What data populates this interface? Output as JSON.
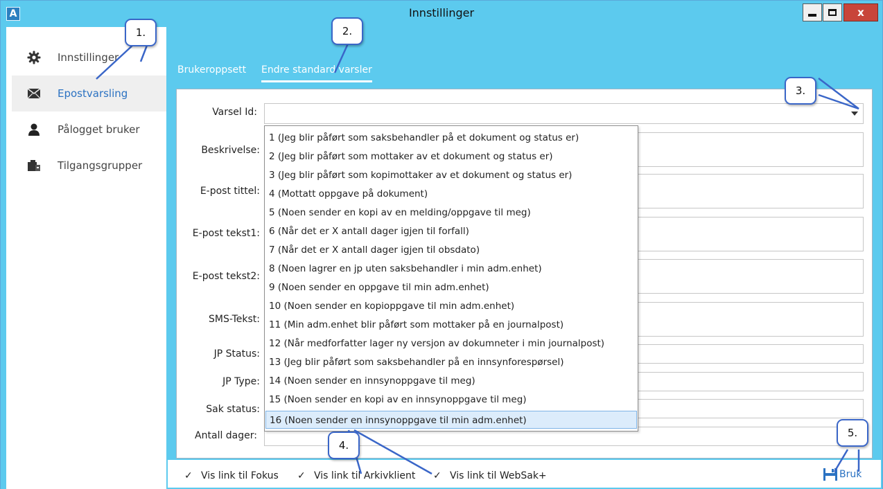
{
  "window": {
    "title": "Innstillinger",
    "app_icon": "A",
    "close_label": "x"
  },
  "sidebar": {
    "items": [
      {
        "label": "Innstillinger",
        "icon": "gear-icon"
      },
      {
        "label": "Epostvarsling",
        "icon": "envelope-icon"
      },
      {
        "label": "Pålogget bruker",
        "icon": "user-icon"
      },
      {
        "label": "Tilgangsgrupper",
        "icon": "group-icon"
      }
    ]
  },
  "tabs": [
    {
      "label": "Brukeroppsett"
    },
    {
      "label": "Endre standard varsler"
    }
  ],
  "form": {
    "labels": {
      "varsel_id": "Varsel Id:",
      "beskrivelse": "Beskrivelse:",
      "epost_tittel": "E-post tittel:",
      "epost_tekst1": "E-post tekst1:",
      "epost_tekst2": "E-post tekst2:",
      "sms_tekst": "SMS-Tekst:",
      "jp_status": "JP Status:",
      "jp_type": "JP Type:",
      "sak_status": "Sak status:",
      "antall_dager": "Antall dager:"
    }
  },
  "dropdown": {
    "options": [
      "1 (Jeg blir påført som saksbehandler på et dokument og status er)",
      "2 (Jeg blir påført som mottaker av et dokument og status er)",
      "3 (Jeg blir påført som kopimottaker av et dokument og status er)",
      "4 (Mottatt oppgave på dokument)",
      "5 (Noen sender en kopi av en melding/oppgave til meg)",
      "6 (Når det er X antall dager igjen til forfall)",
      "7 (Når det er X antall dager igjen til obsdato)",
      "8 (Noen lagrer en jp uten saksbehandler i min adm.enhet)",
      "9 (Noen sender en oppgave til min adm.enhet)",
      "10 (Noen sender en kopioppgave til min adm.enhet)",
      "11 (Min adm.enhet blir påført som mottaker på en journalpost)",
      "12 (Når medforfatter lager ny versjon av dokumneter i min journalpost)",
      "13 (Jeg blir påført som saksbehandler på en innsynforespørsel)",
      "14 (Noen sender en innsynoppgave til meg)",
      "15 (Noen sender en kopi av en innsynoppgave til meg)",
      "16 (Noen sender en innsynoppgave til min adm.enhet)"
    ],
    "selected_index": 15
  },
  "footer": {
    "checkboxes": [
      {
        "label": "Vis link til Fokus",
        "checked": true
      },
      {
        "label": "Vis link til Arkivklient",
        "checked": true
      },
      {
        "label": "Vis link til WebSak+",
        "checked": true
      }
    ],
    "apply_label": "Bruk"
  },
  "callouts": [
    "1.",
    "2.",
    "3.",
    "4.",
    "5."
  ],
  "colors": {
    "accent": "#5ccaee",
    "link_blue": "#2b72c2",
    "callout_border": "#3a66c8",
    "selected_bg": "#dcecfb"
  }
}
